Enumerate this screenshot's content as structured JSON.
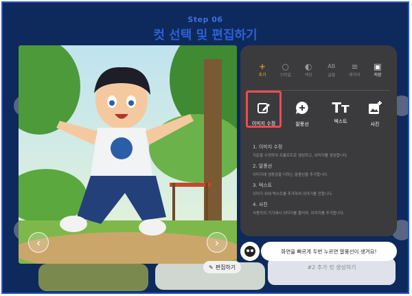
{
  "header": {
    "step": "Step 06",
    "title": "컷 선택 및 편집하기"
  },
  "image": {
    "edit_label": "편집하기"
  },
  "tabs": [
    {
      "label": "추가",
      "icon": "plus-icon",
      "active": true
    },
    {
      "label": "스타일",
      "icon": "chat-outline-icon"
    },
    {
      "label": "색상",
      "icon": "palette-icon"
    },
    {
      "label": "글꼴",
      "icon": "font-icon"
    },
    {
      "label": "레이어",
      "icon": "layers-icon"
    },
    {
      "label": "저장",
      "icon": "save-icon"
    }
  ],
  "tools": [
    {
      "label": "이미지 수정",
      "icon": "edit-image-icon",
      "selected": true
    },
    {
      "label": "말풍선",
      "icon": "speech-bubble-plus-icon"
    },
    {
      "label": "텍스트",
      "icon": "text-icon"
    },
    {
      "label": "사진",
      "icon": "photo-add-icon"
    }
  ],
  "descriptions": [
    {
      "title": "1. 이미지 수정",
      "text": "지문을 수정하여 프롬프트로 생성하고, 이미지를 생성합니다."
    },
    {
      "title": "2. 말풍선",
      "text": "이미지에 생동감을 더하는 말풍선을 추가합니다."
    },
    {
      "title": "3. 텍스트",
      "text": "이미지 위에 텍스트를 추가하여 이야기를 전합니다."
    },
    {
      "title": "4. 사진",
      "text": "사용자의 기기에서 이미지를 불러와, 이미지를 추가합니다."
    }
  ],
  "tip": "화면을 빠르게 두번 누르면 말풍선이 생겨요!",
  "bottom_card": {
    "label": "#2 추가 컷 생성하기"
  },
  "colors": {
    "background": "#0e2a5c",
    "panel": "#3b3b3d",
    "accent": "#f2b632",
    "highlight": "#ef4b4f",
    "frame": "#2a56c8"
  }
}
